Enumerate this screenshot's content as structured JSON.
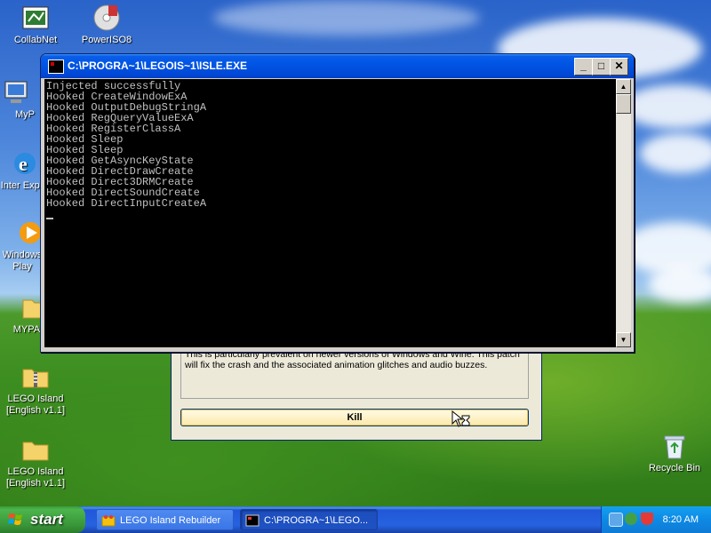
{
  "desktop": {
    "icons": [
      {
        "id": "collabnet",
        "label": "CollabNet"
      },
      {
        "id": "poweriso",
        "label": "PowerISO8"
      },
      {
        "id": "mypc",
        "label": "MyP"
      },
      {
        "id": "ie",
        "label": "Inter Explo"
      },
      {
        "id": "wmp",
        "label": "Windows Play"
      },
      {
        "id": "mypal",
        "label": "MYPAL"
      },
      {
        "id": "lego1",
        "label": "LEGO Island [English v1.1]"
      },
      {
        "id": "lego2",
        "label": "LEGO Island [English v1.1]"
      },
      {
        "id": "recycle",
        "label": "Recycle Bin"
      }
    ]
  },
  "console": {
    "title": "C:\\PROGRA~1\\LEGOIS~1\\ISLE.EXE",
    "lines": [
      "Injected successfully",
      "Hooked CreateWindowExA",
      "Hooked OutputDebugStringA",
      "Hooked RegQueryValueExA",
      "Hooked RegisterClassA",
      "Hooked Sleep",
      "Hooked Sleep",
      "Hooked GetAsyncKeyState",
      "Hooked DirectDrawCreate",
      "Hooked Direct3DRMCreate",
      "Hooked DirectSoundCreate",
      "Hooked DirectInputCreateA"
    ],
    "minimize": "_",
    "maximize": "□",
    "close": "✕"
  },
  "rebuilder": {
    "description": "This is particularly prevalent on newer versions of Windows and Wine. This patch will fix the crash and the associated animation glitches and audio buzzes.",
    "kill_label": "Kill"
  },
  "taskbar": {
    "start_label": "start",
    "tasks": [
      {
        "label": "LEGO Island Rebuilder",
        "icon": "lego-icon",
        "active": false
      },
      {
        "label": "C:\\PROGRA~1\\LEGO...",
        "icon": "console-icon",
        "active": true
      }
    ],
    "clock": "8:20 AM"
  },
  "colors": {
    "titlebar": "#0055e5",
    "taskbar": "#2663e0",
    "start": "#3c9a3c",
    "console_bg": "#000000",
    "console_text": "#c0c0c0"
  }
}
